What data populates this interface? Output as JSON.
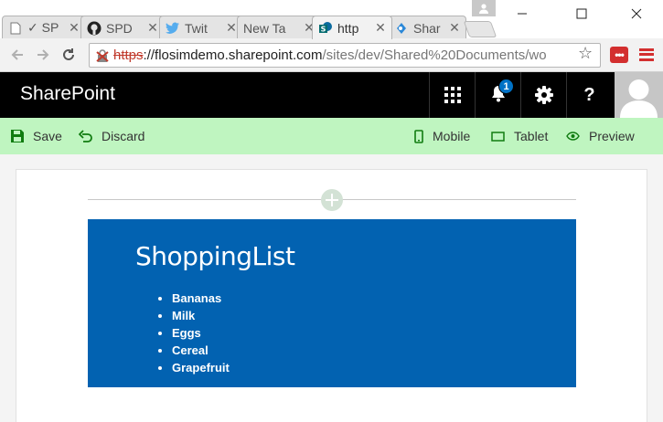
{
  "browser": {
    "tabs": [
      {
        "title": "✓ SP",
        "icon": "page-icon",
        "active": false
      },
      {
        "title": "SPD",
        "icon": "github-icon",
        "active": false
      },
      {
        "title": "Twit",
        "icon": "twitter-icon",
        "active": false
      },
      {
        "title": "New Ta",
        "icon": "none",
        "active": false
      },
      {
        "title": "http",
        "icon": "sharepoint-icon",
        "active": true
      },
      {
        "title": "Shar",
        "icon": "sharepoint-icon",
        "active": false
      }
    ],
    "address": {
      "scheme": "https",
      "host": "://flosimdemo.sharepoint.com",
      "path": "/sites/dev/Shared%20Documents/wo"
    },
    "extension_label": "•••"
  },
  "suitebar": {
    "brand": "SharePoint",
    "notification_count": "1",
    "help_label": "?"
  },
  "commandbar": {
    "save": "Save",
    "discard": "Discard",
    "mobile": "Mobile",
    "tablet": "Tablet",
    "preview": "Preview"
  },
  "webpart": {
    "title": "ShoppingList",
    "items": [
      "Bananas",
      "Milk",
      "Eggs",
      "Cereal",
      "Grapefruit"
    ]
  },
  "colors": {
    "suitebar_bg": "#000000",
    "commandbar_bg": "#bff5c0",
    "webpart_bg": "#0262b1",
    "accent_green": "#107c10",
    "badge_blue": "#0072c6"
  }
}
